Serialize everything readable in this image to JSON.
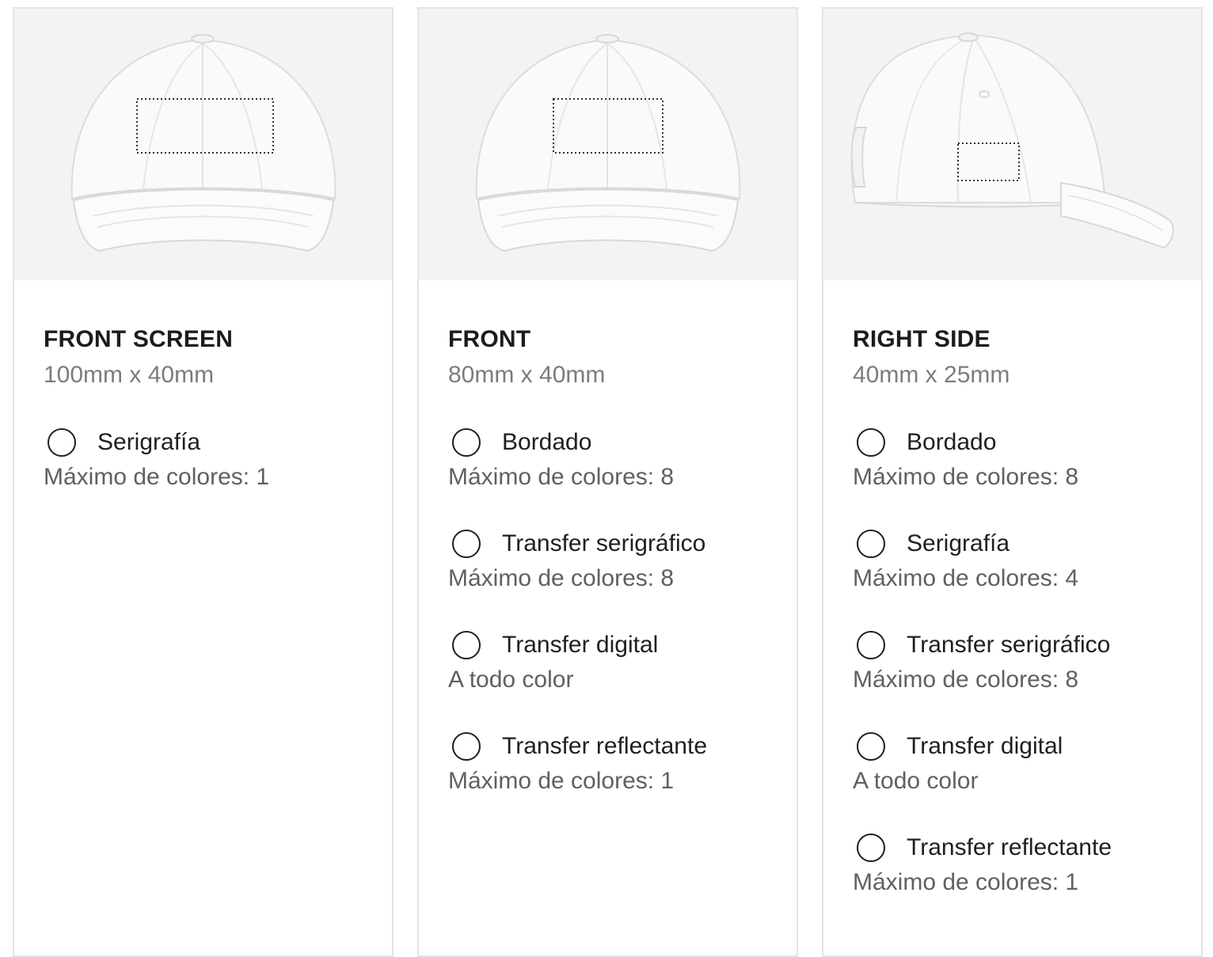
{
  "cards": [
    {
      "title": "FRONT SCREEN",
      "dims": "100mm x 40mm",
      "view": "front",
      "options": [
        {
          "label": "Serigrafía",
          "desc": "Máximo de colores: 1"
        }
      ]
    },
    {
      "title": "FRONT",
      "dims": "80mm x 40mm",
      "view": "front",
      "options": [
        {
          "label": "Bordado",
          "desc": "Máximo de colores: 8"
        },
        {
          "label": "Transfer serigráfico",
          "desc": "Máximo de colores: 8"
        },
        {
          "label": "Transfer digital",
          "desc": "A todo color"
        },
        {
          "label": "Transfer reflectante",
          "desc": "Máximo de colores: 1"
        }
      ]
    },
    {
      "title": "RIGHT SIDE",
      "dims": "40mm x 25mm",
      "view": "side",
      "options": [
        {
          "label": "Bordado",
          "desc": "Máximo de colores: 8"
        },
        {
          "label": "Serigrafía",
          "desc": "Máximo de colores: 4"
        },
        {
          "label": "Transfer serigráfico",
          "desc": "Máximo de colores: 8"
        },
        {
          "label": "Transfer digital",
          "desc": "A todo color"
        },
        {
          "label": "Transfer reflectante",
          "desc": "Máximo de colores: 1"
        }
      ]
    }
  ],
  "colors": {
    "card_border": "#e4e4e4",
    "image_bg": "#f3f3f3",
    "cap": "#f7f7f7",
    "title": "#1c1c1c",
    "dims": "#7c7c7c",
    "desc": "#606060"
  }
}
